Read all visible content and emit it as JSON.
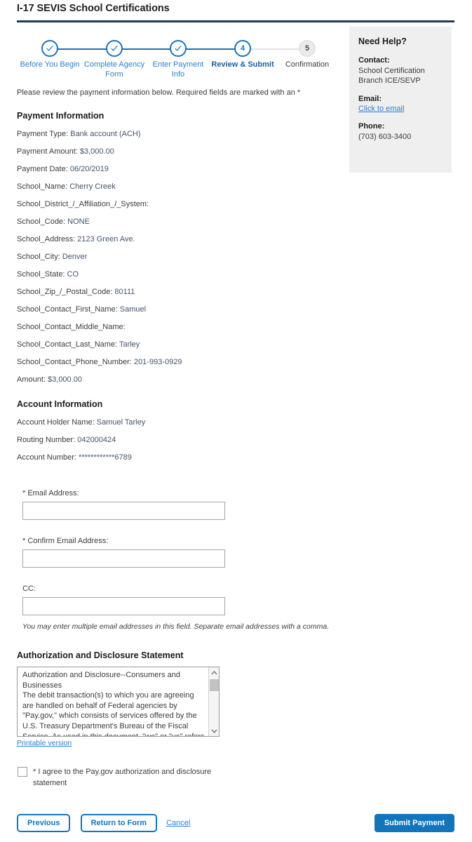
{
  "page": {
    "title": "I-17 SEVIS School Certifications",
    "intro": "Please review the payment information below. Required fields are marked with an *"
  },
  "help": {
    "title": "Need Help?",
    "contact_label": "Contact:",
    "contact_line1": "School Certification",
    "contact_line2": "Branch ICE/SEVP",
    "email_label": "Email:",
    "email_link": "Click to email",
    "phone_label": "Phone:",
    "phone_value": "(703) 603-3400"
  },
  "stepper": {
    "steps": [
      {
        "label": "Before You Begin",
        "state": "complete",
        "marker": "check"
      },
      {
        "label": "Complete Agency Form",
        "state": "complete",
        "marker": "check"
      },
      {
        "label": "Enter Payment Info",
        "state": "complete",
        "marker": "check"
      },
      {
        "label": "Review & Submit",
        "state": "current",
        "marker": "4"
      },
      {
        "label": "Confirmation",
        "state": "inactive",
        "marker": "5"
      }
    ]
  },
  "payment_information": {
    "heading": "Payment Information",
    "rows": [
      {
        "label": "Payment Type:",
        "value": "Bank account (ACH)"
      },
      {
        "label": "Payment Amount:",
        "value": "$3,000.00"
      },
      {
        "label": "Payment Date:",
        "value": "06/20/2019"
      },
      {
        "label": "School_Name:",
        "value": "Cherry Creek"
      },
      {
        "label": "School_District_/_Affiliation_/_System:",
        "value": ""
      },
      {
        "label": "School_Code:",
        "value": "NONE"
      },
      {
        "label": "School_Address:",
        "value": "2123 Green Ave."
      },
      {
        "label": "School_City:",
        "value": "Denver"
      },
      {
        "label": "School_State:",
        "value": "CO"
      },
      {
        "label": "School_Zip_/_Postal_Code:",
        "value": "80111"
      },
      {
        "label": "School_Contact_First_Name:",
        "value": "Samuel"
      },
      {
        "label": "School_Contact_Middle_Name:",
        "value": ""
      },
      {
        "label": "School_Contact_Last_Name:",
        "value": "Tarley"
      },
      {
        "label": "School_Contact_Phone_Number:",
        "value": "201-993-0929"
      },
      {
        "label": "Amount:",
        "value": "$3,000.00"
      }
    ]
  },
  "account_information": {
    "heading": "Account Information",
    "rows": [
      {
        "label": "Account Holder Name:",
        "value": "Samuel Tarley"
      },
      {
        "label": "Routing Number:",
        "value": "042000424"
      },
      {
        "label": "Account Number:",
        "value": "************6789"
      }
    ]
  },
  "email_section": {
    "email_label": "* Email Address:",
    "email_value": "",
    "confirm_label": "* Confirm Email Address:",
    "confirm_value": "",
    "cc_label": "CC:",
    "cc_value": "",
    "hint": "You may enter multiple email addresses in this field. Separate email addresses with a comma."
  },
  "authorization": {
    "heading": "Authorization and Disclosure Statement",
    "body": "Authorization and Disclosure--Consumers and Businesses\nThe debit transaction(s) to which you are agreeing are handled on behalf of Federal agencies by \"Pay.gov,\" which consists of services offered by the U.S. Treasury Department's Bureau of the Fiscal Service. As used in this document, \"we\" or \"us\" refers to the",
    "printable_link": "Printable version",
    "agree_text": "* I agree to the Pay.gov authorization and disclosure statement",
    "agree_checked": false
  },
  "footer": {
    "previous_label": "Previous",
    "return_label": "Return to Form",
    "cancel_label": "Cancel",
    "submit_label": "Submit Payment"
  },
  "colors": {
    "rule": "#22385c",
    "primary": "#1275bc",
    "link": "#2b7fd4",
    "step_done": "#1b72b8",
    "step_todo": "#e2e2e2",
    "panel_bg": "#efefef"
  }
}
